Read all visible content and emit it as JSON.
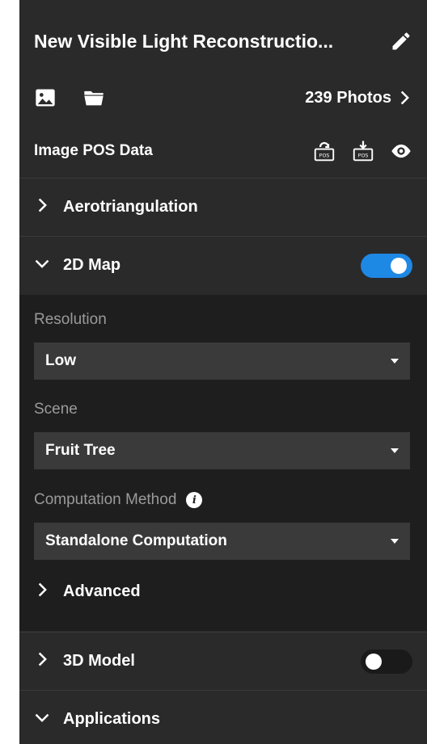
{
  "header": {
    "title": "New Visible Light Reconstructio..."
  },
  "photos": {
    "count_label": "239 Photos"
  },
  "pos_data": {
    "label": "Image POS Data"
  },
  "sections": {
    "aerotriangulation": "Aerotriangulation",
    "map2d": {
      "label": "2D Map",
      "enabled": true
    },
    "model3d": {
      "label": "3D Model",
      "enabled": false
    },
    "applications": "Applications"
  },
  "map2d_settings": {
    "resolution": {
      "label": "Resolution",
      "value": "Low"
    },
    "scene": {
      "label": "Scene",
      "value": "Fruit Tree"
    },
    "computation": {
      "label": "Computation Method",
      "value": "Standalone Computation",
      "info": "i"
    },
    "advanced": "Advanced"
  },
  "colors": {
    "panel": "#2a2a2a",
    "sub_panel": "#1e1e1e",
    "accent": "#1e88e5",
    "muted_text": "#9a9a9a"
  },
  "icons": [
    "pencil-icon",
    "image-icon",
    "folder-icon",
    "chevron-right-icon",
    "pos-import-icon",
    "pos-export-icon",
    "eye-icon",
    "chevron-down-icon",
    "info-icon"
  ]
}
